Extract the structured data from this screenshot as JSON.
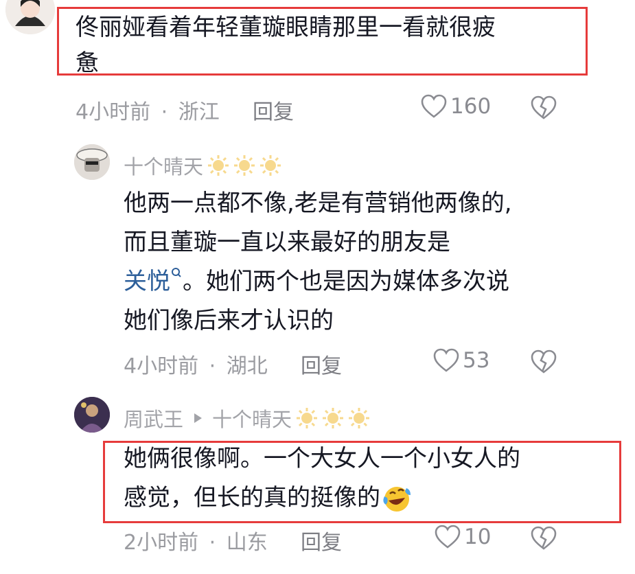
{
  "comment1": {
    "text_line1": "佟丽娅看着年轻董璇眼睛那里一看就很疲",
    "text_line2": "惫",
    "time": "4小时前",
    "location": "浙江",
    "reply": "回复",
    "likes": "160"
  },
  "reply1": {
    "user": "十个晴天",
    "line1": "他两一点都不像,老是有营销他两像的,",
    "line2": "而且董璇一直以来最好的朋友是",
    "link": "关悦",
    "line3_rest": "。她们两个也是因为媒体多次说",
    "line4": "她们像后来才认识的",
    "time": "4小时前",
    "location": "湖北",
    "reply": "回复",
    "likes": "53"
  },
  "reply2": {
    "user": "周武王",
    "reply_to": "十个晴天",
    "line1": "她俩很像啊。一个大女人一个小女人的",
    "line2": "感觉，但长的真的挺像的",
    "time": "2小时前",
    "location": "山东",
    "reply": "回复",
    "likes": "10"
  },
  "separator": "·",
  "colors": {
    "highlight_box": "#e63b3b",
    "link": "#2d5f9a",
    "meta": "#9a9ba0"
  }
}
